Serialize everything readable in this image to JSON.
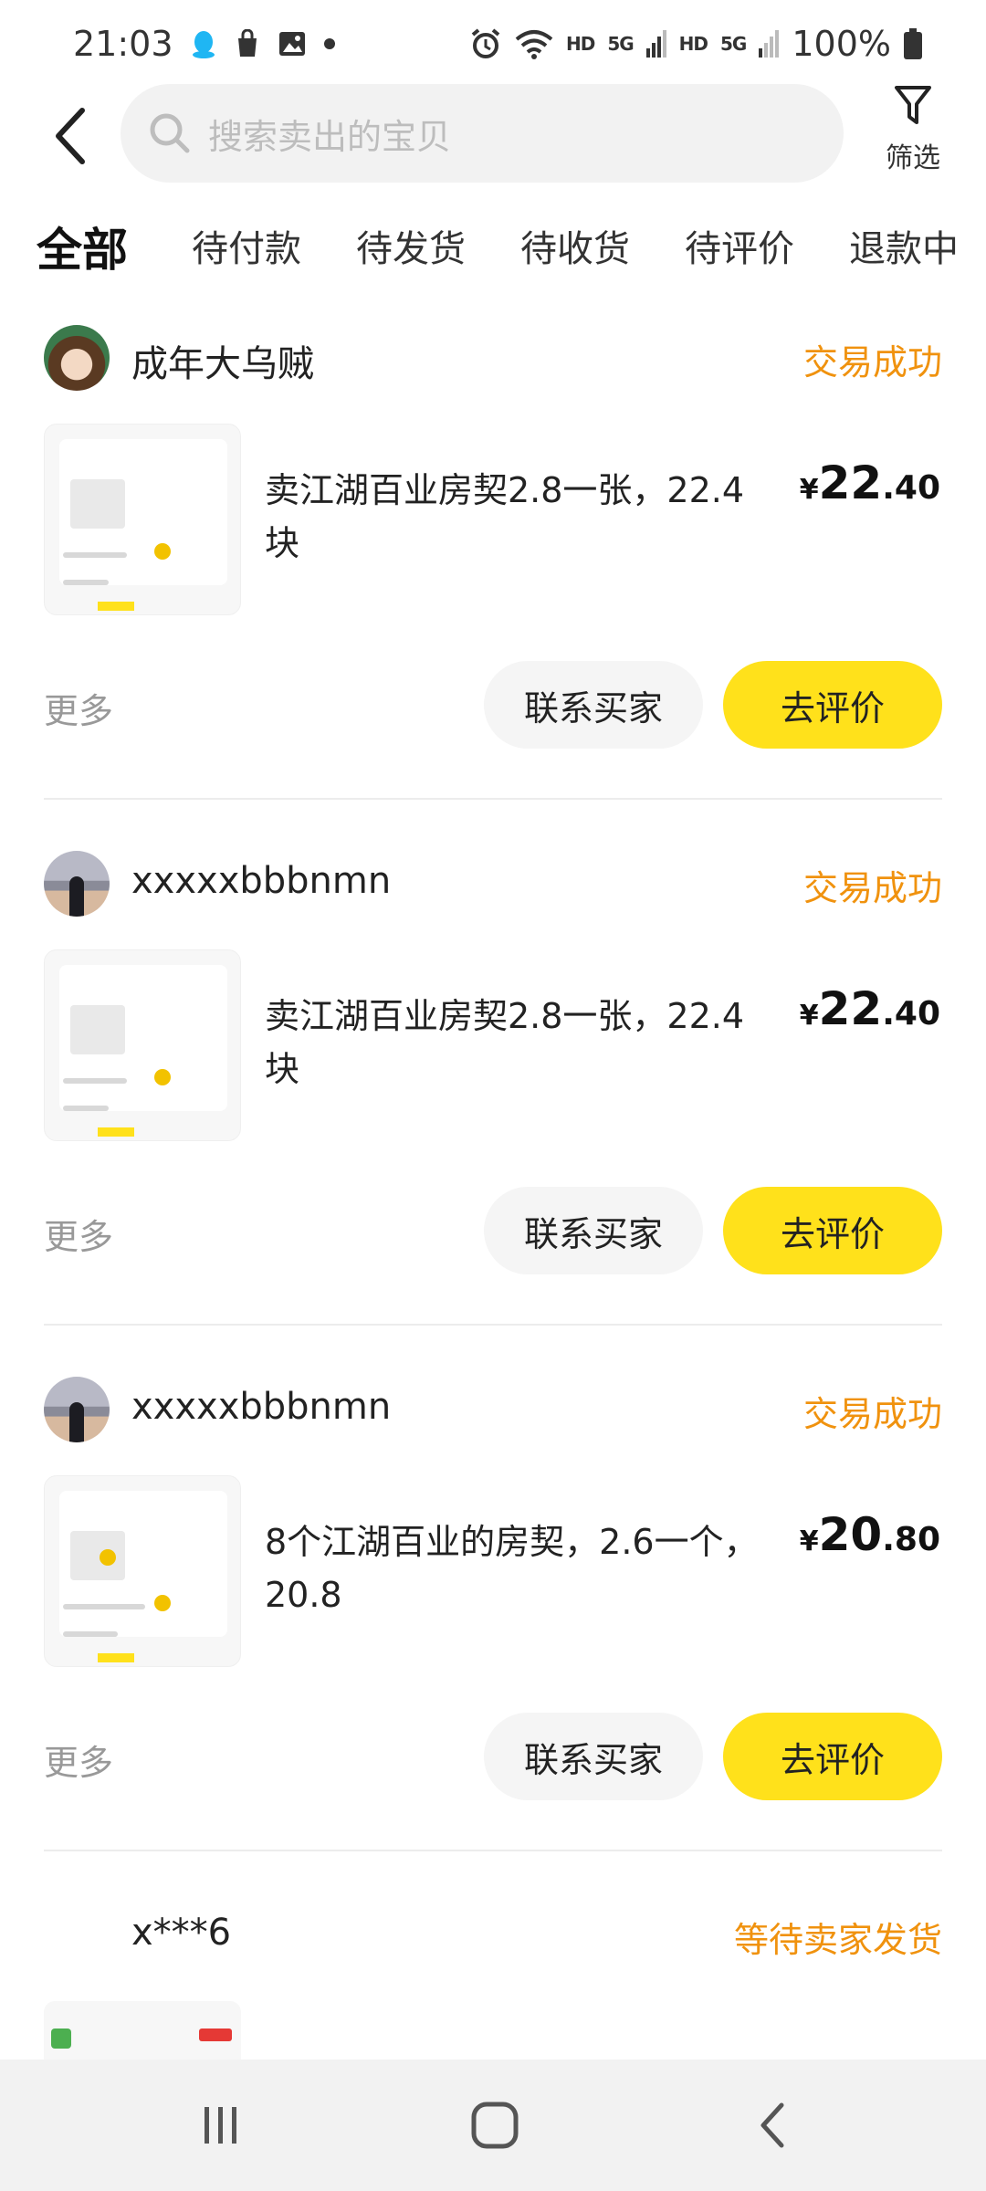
{
  "status_bar": {
    "time": "21:03",
    "hd1": "HD",
    "net1": "5G",
    "hd2": "HD",
    "net2": "5G",
    "battery": "100%"
  },
  "header": {
    "search_placeholder": "搜索卖出的宝贝",
    "filter_label": "筛选"
  },
  "tabs": [
    {
      "label": "全部",
      "active": true
    },
    {
      "label": "待付款",
      "active": false
    },
    {
      "label": "待发货",
      "active": false
    },
    {
      "label": "待收货",
      "active": false
    },
    {
      "label": "待评价",
      "active": false
    },
    {
      "label": "退款中",
      "active": false
    }
  ],
  "orders": [
    {
      "username": "成年大乌贼",
      "status": "交易成功",
      "title": "卖江湖百业房契2.8一张，22.4块",
      "price_currency": "¥",
      "price_int": "22",
      "price_dec": ".40",
      "more_label": "更多",
      "contact_label": "联系买家",
      "review_label": "去评价"
    },
    {
      "username": "xxxxxbbbnmn",
      "status": "交易成功",
      "title": "卖江湖百业房契2.8一张，22.4块",
      "price_currency": "¥",
      "price_int": "22",
      "price_dec": ".40",
      "more_label": "更多",
      "contact_label": "联系买家",
      "review_label": "去评价"
    },
    {
      "username": "xxxxxbbbnmn",
      "status": "交易成功",
      "title": "8个江湖百业的房契，2.6一个，20.8",
      "price_currency": "¥",
      "price_int": "20",
      "price_dec": ".80",
      "more_label": "更多",
      "contact_label": "联系买家",
      "review_label": "去评价"
    },
    {
      "username": "x***6",
      "status": "等待卖家发货"
    }
  ],
  "colors": {
    "accent_yellow": "#ffe11b",
    "status_orange": "#f0920e"
  }
}
